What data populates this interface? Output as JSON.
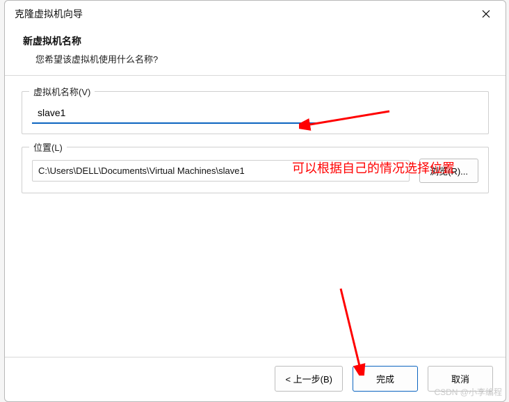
{
  "titlebar": {
    "title": "克隆虚拟机向导"
  },
  "header": {
    "heading": "新虚拟机名称",
    "subheading": "您希望该虚拟机使用什么名称?"
  },
  "name_group": {
    "label": "虚拟机名称(V)",
    "value": "slave1"
  },
  "location_group": {
    "label": "位置(L)",
    "value": "C:\\Users\\DELL\\Documents\\Virtual Machines\\slave1",
    "browse_label": "浏览(R)..."
  },
  "annotation": {
    "text": "可以根据自己的情况选择位置"
  },
  "footer": {
    "back_label": "< 上一步(B)",
    "finish_label": "完成",
    "cancel_label": "取消"
  },
  "watermark": "CSDN @小李编程"
}
